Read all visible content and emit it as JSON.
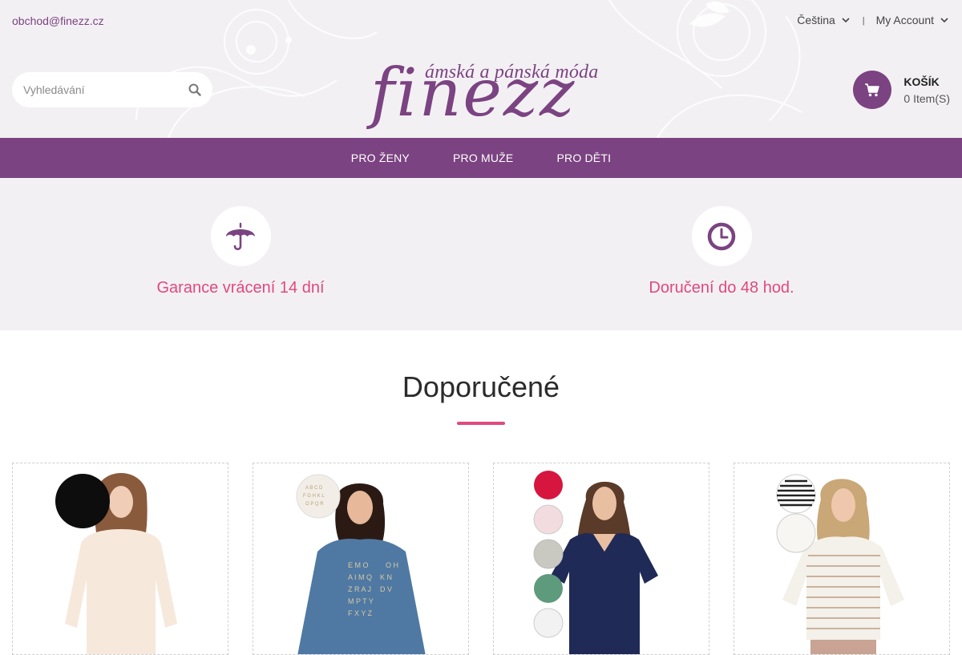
{
  "header": {
    "email": "obchod@finezz.cz",
    "language": "Čeština",
    "separator": "|",
    "account": "My Account",
    "search_placeholder": "Vyhledávání",
    "logo_tagline": "ámská a pánská móda",
    "logo_brand": "finezz",
    "cart_title": "KOŠÍK",
    "cart_count": "0 Item(S)"
  },
  "nav": {
    "items": [
      {
        "label": "PRO ŽENY"
      },
      {
        "label": "PRO MUŽE"
      },
      {
        "label": "PRO DĚTI"
      }
    ]
  },
  "features": [
    {
      "text": "Garance vrácení 14 dní",
      "icon": "umbrella-icon"
    },
    {
      "text": "Doručení do 48 hod.",
      "icon": "clock-icon"
    }
  ],
  "featured": {
    "title": "Doporučené"
  },
  "products": [
    {
      "image": "cream-top-product",
      "swatches": [
        "#000000"
      ]
    },
    {
      "image": "blue-letter-top-product",
      "swatches": [
        "#f2eee7"
      ]
    },
    {
      "image": "navy-vneck-tshirt-product",
      "swatches": [
        "#d6163f",
        "#f2dcdf",
        "#c9c9c2",
        "#5e9a7c",
        "#f2f2f2"
      ]
    },
    {
      "image": "striped-top-product",
      "swatches": [
        "#222222",
        "#f7f6f2"
      ]
    }
  ],
  "colors": {
    "brand": "#7b4381",
    "accent": "#e0497e",
    "header_bg": "#f3f0f4"
  }
}
